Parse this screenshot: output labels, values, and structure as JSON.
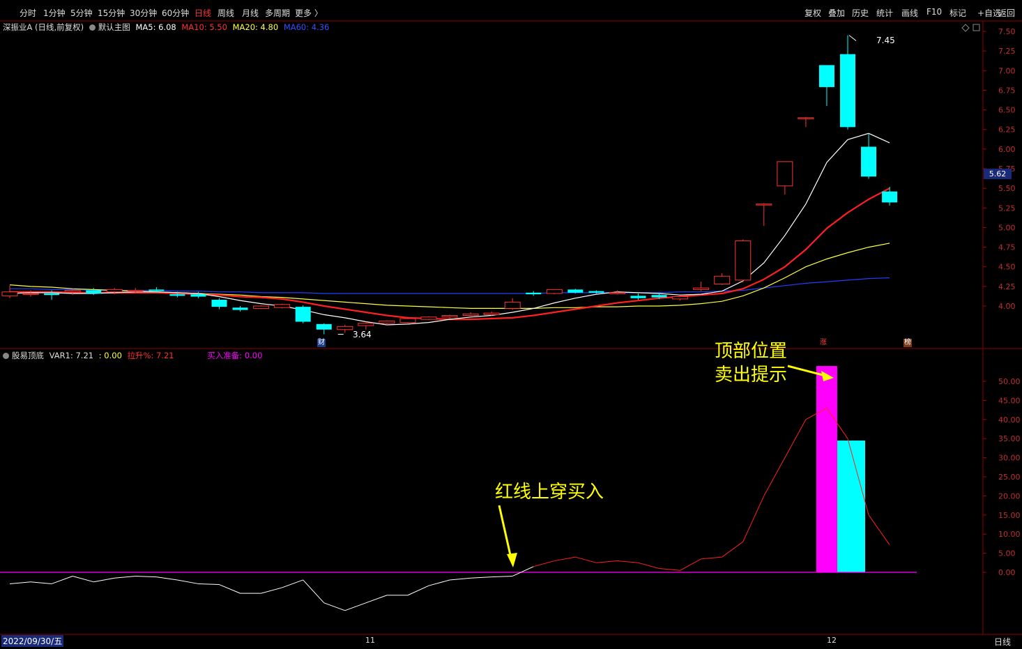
{
  "toolbar": {
    "periods": [
      "分时",
      "1分钟",
      "5分钟",
      "15分钟",
      "30分钟",
      "60分钟",
      "日线",
      "周线",
      "月线",
      "多周期",
      "更多 〉"
    ],
    "active": "日线",
    "right": [
      "复权",
      "叠加",
      "历史",
      "统计",
      "画线",
      "F10",
      "标记",
      "+自选",
      "返回"
    ]
  },
  "main_info": {
    "stock": "深振业A (日线,前复权)",
    "template": "默认主图",
    "ma5": "MA5: 6.08",
    "ma10": "MA10: 5.50",
    "ma20": "MA20: 4.80",
    "ma60": "MA60: 4.36"
  },
  "ind_info": {
    "name": "股易顶底",
    "var1": "VAR1: 7.21",
    "v2": ": 0.00",
    "lift": "拉升%: 7.21",
    "buy": "买入准备: 0.00"
  },
  "price_tag": "5.62",
  "labels": {
    "high": "7.45",
    "low": "3.64",
    "cai": "财",
    "zhang": "涨",
    "bang": "榜"
  },
  "annotations": {
    "top_line1": "顶部位置",
    "top_line2": "卖出提示",
    "buy": "红线上穿买入"
  },
  "date_label": "2022/09/30/五",
  "x_ticks": [
    "11",
    "12"
  ],
  "period_label": "日线",
  "colors": {
    "up": "#ff3232",
    "down": "#00ffff",
    "ma5": "#ffffff",
    "ma10": "#ff2020",
    "ma20": "#ffff40",
    "ma60": "#2040ff",
    "magenta": "#ff00ff"
  },
  "chart_data": [
    {
      "type": "candlestick",
      "title": "深振业A (日线,前复权)",
      "ylim": [
        3.5,
        7.6
      ],
      "yticks": [
        "7.50",
        "7.25",
        "7.00",
        "6.75",
        "6.50",
        "6.25",
        "6.00",
        "5.75",
        "5.50",
        "5.25",
        "5.00",
        "4.75",
        "4.50",
        "4.25",
        "4.00"
      ],
      "candles": [
        {
          "o": 4.13,
          "h": 4.26,
          "l": 4.1,
          "c": 4.18
        },
        {
          "o": 4.15,
          "h": 4.2,
          "l": 4.12,
          "c": 4.16
        },
        {
          "o": 4.16,
          "h": 4.2,
          "l": 4.08,
          "c": 4.14
        },
        {
          "o": 4.18,
          "h": 4.22,
          "l": 4.14,
          "c": 4.2
        },
        {
          "o": 4.2,
          "h": 4.23,
          "l": 4.14,
          "c": 4.16
        },
        {
          "o": 4.18,
          "h": 4.23,
          "l": 4.15,
          "c": 4.21
        },
        {
          "o": 4.19,
          "h": 4.23,
          "l": 4.16,
          "c": 4.2
        },
        {
          "o": 4.21,
          "h": 4.24,
          "l": 4.17,
          "c": 4.19
        },
        {
          "o": 4.15,
          "h": 4.18,
          "l": 4.11,
          "c": 4.13
        },
        {
          "o": 4.15,
          "h": 4.18,
          "l": 4.1,
          "c": 4.12
        },
        {
          "o": 4.08,
          "h": 4.1,
          "l": 3.96,
          "c": 3.99
        },
        {
          "o": 3.98,
          "h": 4.0,
          "l": 3.93,
          "c": 3.95
        },
        {
          "o": 3.97,
          "h": 4.01,
          "l": 3.96,
          "c": 4.0
        },
        {
          "o": 3.98,
          "h": 4.03,
          "l": 3.97,
          "c": 4.02
        },
        {
          "o": 3.99,
          "h": 4.01,
          "l": 3.78,
          "c": 3.8
        },
        {
          "o": 3.77,
          "h": 3.78,
          "l": 3.64,
          "c": 3.7
        },
        {
          "o": 3.7,
          "h": 3.76,
          "l": 3.66,
          "c": 3.74
        },
        {
          "o": 3.75,
          "h": 3.8,
          "l": 3.7,
          "c": 3.78
        },
        {
          "o": 3.78,
          "h": 3.82,
          "l": 3.76,
          "c": 3.81
        },
        {
          "o": 3.79,
          "h": 3.86,
          "l": 3.78,
          "c": 3.84
        },
        {
          "o": 3.83,
          "h": 3.87,
          "l": 3.82,
          "c": 3.86
        },
        {
          "o": 3.86,
          "h": 3.89,
          "l": 3.84,
          "c": 3.88
        },
        {
          "o": 3.88,
          "h": 3.92,
          "l": 3.87,
          "c": 3.9
        },
        {
          "o": 3.89,
          "h": 3.93,
          "l": 3.87,
          "c": 3.91
        },
        {
          "o": 3.97,
          "h": 4.1,
          "l": 3.95,
          "c": 4.05
        },
        {
          "o": 4.17,
          "h": 4.19,
          "l": 4.13,
          "c": 4.15
        },
        {
          "o": 4.16,
          "h": 4.21,
          "l": 4.15,
          "c": 4.21
        },
        {
          "o": 4.21,
          "h": 4.22,
          "l": 4.16,
          "c": 4.17
        },
        {
          "o": 4.19,
          "h": 4.2,
          "l": 4.16,
          "c": 4.17
        },
        {
          "o": 4.17,
          "h": 4.2,
          "l": 4.15,
          "c": 4.17
        },
        {
          "o": 4.13,
          "h": 4.16,
          "l": 4.08,
          "c": 4.1
        },
        {
          "o": 4.14,
          "h": 4.17,
          "l": 4.09,
          "c": 4.11
        },
        {
          "o": 4.09,
          "h": 4.13,
          "l": 4.07,
          "c": 4.12
        },
        {
          "o": 4.21,
          "h": 4.31,
          "l": 4.19,
          "c": 4.23
        },
        {
          "o": 4.28,
          "h": 4.42,
          "l": 4.27,
          "c": 4.38
        },
        {
          "o": 4.33,
          "h": 4.85,
          "l": 4.3,
          "c": 4.83
        },
        {
          "o": 5.3,
          "h": 5.31,
          "l": 5.02,
          "c": 5.3
        },
        {
          "o": 5.53,
          "h": 5.84,
          "l": 5.42,
          "c": 5.84
        },
        {
          "o": 6.4,
          "h": 6.41,
          "l": 6.28,
          "c": 6.4
        },
        {
          "o": 7.07,
          "h": 7.07,
          "l": 6.55,
          "c": 6.79
        },
        {
          "o": 7.21,
          "h": 7.45,
          "l": 6.25,
          "c": 6.28
        },
        {
          "o": 6.03,
          "h": 6.2,
          "l": 5.62,
          "c": 5.65
        },
        {
          "o": 5.46,
          "h": 5.52,
          "l": 5.28,
          "c": 5.32
        }
      ],
      "ma5": [
        4.16,
        4.17,
        4.17,
        4.16,
        4.16,
        4.17,
        4.18,
        4.18,
        4.17,
        4.16,
        4.12,
        4.07,
        4.03,
        4.0,
        3.95,
        3.89,
        3.85,
        3.8,
        3.76,
        3.77,
        3.79,
        3.83,
        3.86,
        3.88,
        3.92,
        3.97,
        4.04,
        4.1,
        4.15,
        4.18,
        4.17,
        4.16,
        4.14,
        4.15,
        4.19,
        4.32,
        4.55,
        4.9,
        5.3,
        5.83,
        6.12,
        6.2,
        6.08
      ],
      "ma10": [
        4.18,
        4.18,
        4.18,
        4.17,
        4.17,
        4.17,
        4.17,
        4.17,
        4.16,
        4.15,
        4.14,
        4.12,
        4.11,
        4.09,
        4.05,
        4.0,
        3.96,
        3.92,
        3.88,
        3.85,
        3.84,
        3.83,
        3.83,
        3.84,
        3.85,
        3.88,
        3.92,
        3.96,
        4.0,
        4.04,
        4.07,
        4.1,
        4.12,
        4.14,
        4.16,
        4.22,
        4.34,
        4.5,
        4.72,
        4.99,
        5.19,
        5.36,
        5.5
      ],
      "ma20": [
        4.27,
        4.25,
        4.24,
        4.22,
        4.21,
        4.2,
        4.19,
        4.18,
        4.17,
        4.16,
        4.15,
        4.14,
        4.12,
        4.11,
        4.09,
        4.07,
        4.05,
        4.03,
        4.01,
        4.0,
        3.99,
        3.98,
        3.97,
        3.97,
        3.97,
        3.97,
        3.98,
        3.98,
        3.99,
        3.99,
        4.0,
        4.0,
        4.01,
        4.03,
        4.06,
        4.13,
        4.23,
        4.36,
        4.5,
        4.6,
        4.68,
        4.75,
        4.8
      ],
      "ma60": [
        4.22,
        4.22,
        4.21,
        4.21,
        4.2,
        4.2,
        4.2,
        4.2,
        4.19,
        4.19,
        4.18,
        4.18,
        4.17,
        4.17,
        4.17,
        4.16,
        4.16,
        4.16,
        4.16,
        4.16,
        4.16,
        4.16,
        4.16,
        4.16,
        4.16,
        4.16,
        4.17,
        4.17,
        4.17,
        4.17,
        4.17,
        4.17,
        4.18,
        4.18,
        4.19,
        4.2,
        4.23,
        4.26,
        4.29,
        4.31,
        4.33,
        4.35,
        4.36
      ]
    },
    {
      "type": "line+bar",
      "title": "股易顶底",
      "ylim": [
        -16,
        55
      ],
      "yticks": [
        "50.00",
        "45.00",
        "40.00",
        "35.00",
        "30.00",
        "25.00",
        "20.00",
        "15.00",
        "10.00",
        "5.00",
        "0.00"
      ],
      "var1": [
        -3,
        -2.5,
        -3,
        -1,
        -2.5,
        -1.5,
        -1,
        -1.2,
        -2,
        -3,
        -3.2,
        -5.5,
        -5.5,
        -4,
        -2,
        -8,
        -10,
        -8,
        -6,
        -6,
        -3.5,
        -2,
        -1.5,
        -1.2,
        -1,
        1.5,
        3,
        4,
        2.5,
        3,
        2.5,
        1,
        0.5,
        3.5,
        4,
        8,
        20,
        30,
        40,
        43,
        35,
        15,
        7.21
      ],
      "top_bar": {
        "index": 39,
        "value": 54
      },
      "cyan_bar": {
        "index": 40,
        "value": 34.5
      }
    }
  ]
}
